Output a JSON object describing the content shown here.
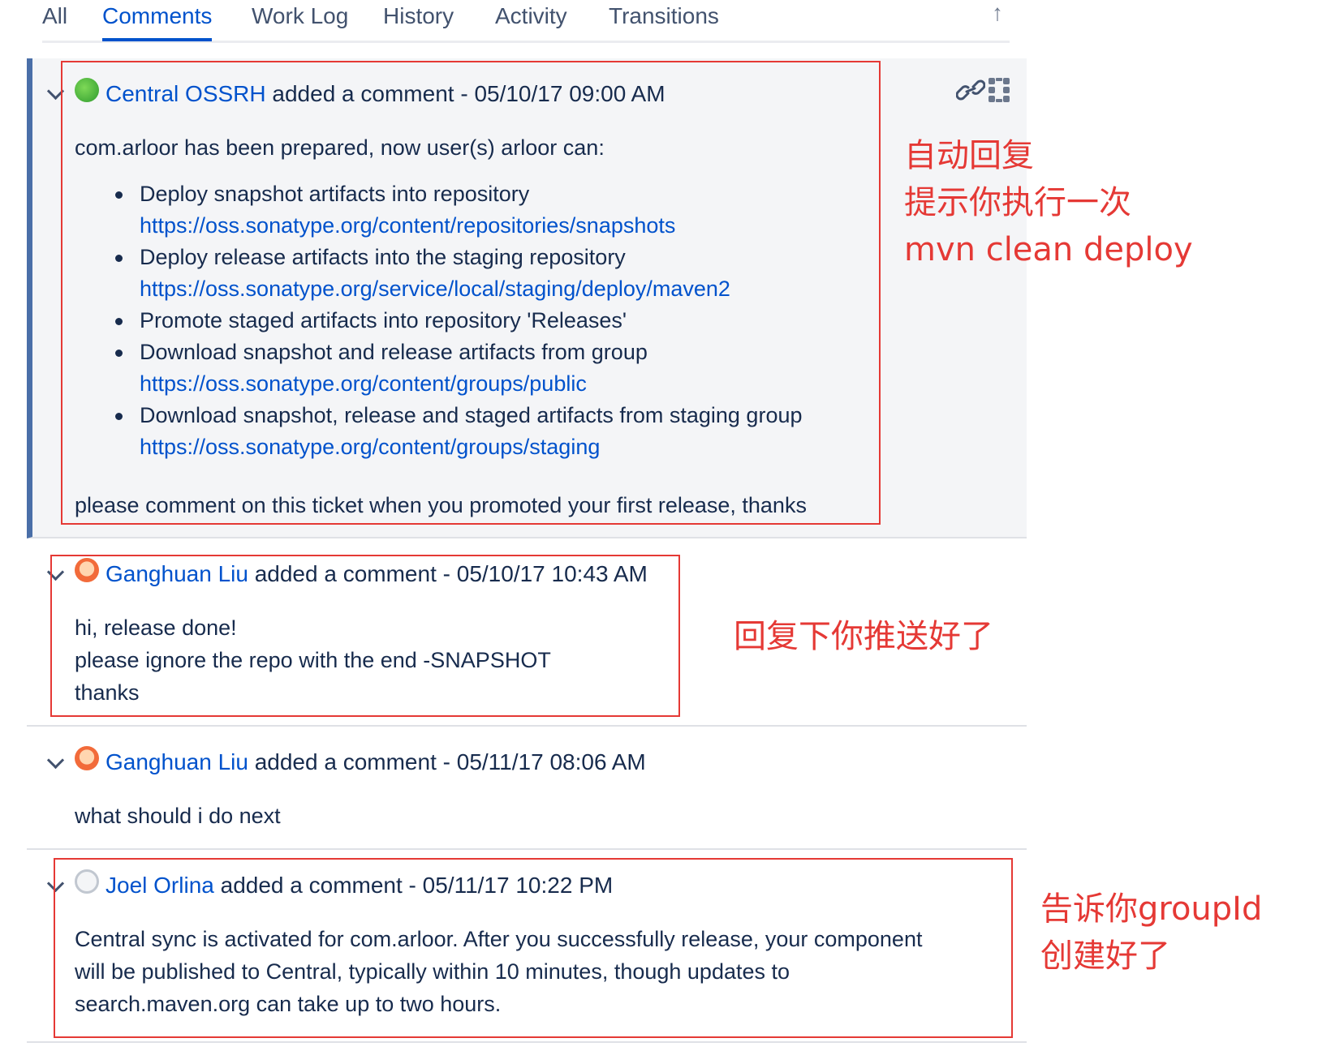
{
  "tabs": {
    "all": "All",
    "comments": "Comments",
    "work_log": "Work Log",
    "history": "History",
    "activity": "Activity",
    "transitions": "Transitions"
  },
  "comments": [
    {
      "author": "Central OSSRH",
      "action": "added a comment -",
      "timestamp": "05/10/17 09:00 AM",
      "intro": "com.arloor has been prepared, now user(s) arloor can:",
      "items": [
        {
          "text": "Deploy snapshot artifacts into repository",
          "link": "https://oss.sonatype.org/content/repositories/snapshots"
        },
        {
          "text": "Deploy release artifacts into the staging repository",
          "link": "https://oss.sonatype.org/service/local/staging/deploy/maven2"
        },
        {
          "text": "Promote staged artifacts into repository 'Releases'",
          "link": ""
        },
        {
          "text": "Download snapshot and release artifacts from group",
          "link": "https://oss.sonatype.org/content/groups/public"
        },
        {
          "text": "Download snapshot, release and staged artifacts from staging group",
          "link": "https://oss.sonatype.org/content/groups/staging"
        }
      ],
      "outro": "please comment on this ticket when you promoted your first release, thanks"
    },
    {
      "author": "Ganghuan Liu",
      "action": "added a comment -",
      "timestamp": "05/10/17 10:43 AM",
      "lines": [
        "hi, release done!",
        "please ignore the repo with the end -SNAPSHOT",
        "thanks"
      ]
    },
    {
      "author": "Ganghuan Liu",
      "action": "added a comment -",
      "timestamp": "05/11/17 08:06 AM",
      "lines": [
        "what should i do next"
      ]
    },
    {
      "author": "Joel Orlina",
      "action": "added a comment -",
      "timestamp": "05/11/17 10:22 PM",
      "lines": [
        "Central sync is activated for com.arloor. After you successfully release, your component",
        "will be published to Central, typically within 10 minutes, though updates to",
        "search.maven.org can take up to two hours."
      ]
    }
  ],
  "annotations": {
    "note1": [
      "自动回复",
      "提示你执行一次",
      "mvn clean deploy"
    ],
    "note2": [
      "回复下你推送好了"
    ],
    "note3": [
      "告诉你groupId",
      "创建好了"
    ]
  },
  "colors": {
    "link": "#0052cc",
    "annotation": "#e53935",
    "comment_highlight_bar": "#4a6fa8",
    "comment_highlight_bg": "#f4f5f7"
  },
  "icons": [
    "arrow-up-icon",
    "link-icon",
    "drag-handle-icon",
    "chevron-down-icon",
    "avatar"
  ]
}
